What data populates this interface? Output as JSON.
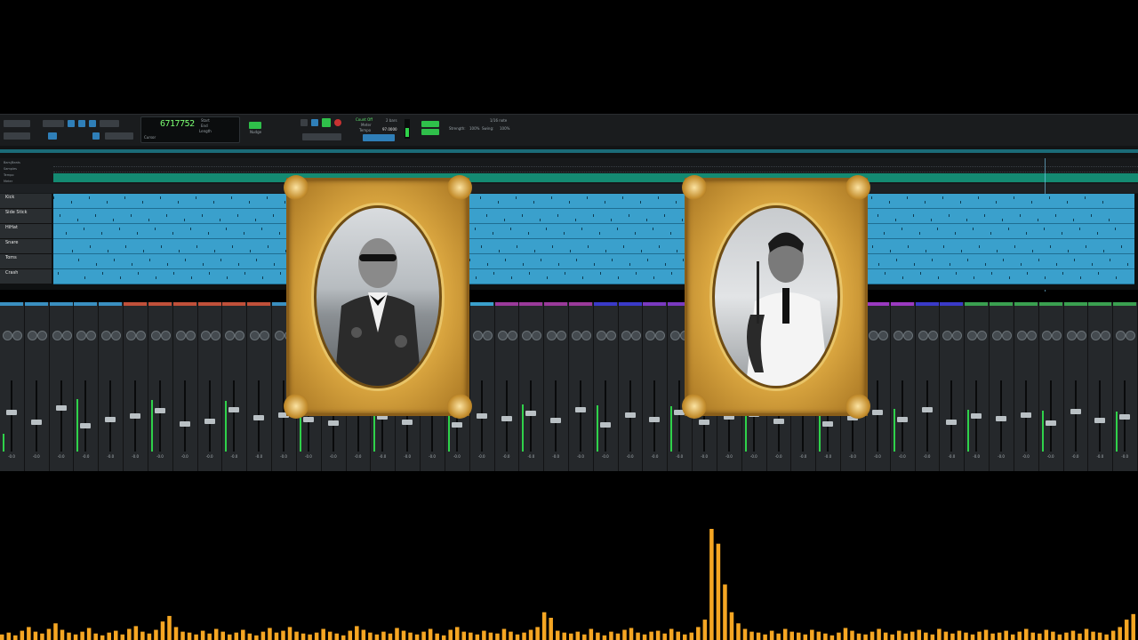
{
  "colors": {
    "accent_blue": "#2f7fb8",
    "counter_green": "#7bff72",
    "clip_blue": "#3aa0cc",
    "tempo_teal": "#148a72",
    "waveform_orange": "#f5a623",
    "frame_gold": "#d9a53f"
  },
  "toolbar": {
    "counter": "6717752",
    "start_label": "Start",
    "end_label": "End",
    "length_label": "Length",
    "cursor_label": "Cursor",
    "grid_label": "Grid",
    "nudge_label": "Nudge",
    "click_label": "Count Off",
    "meter_label": "Meter",
    "tempo_label": "Tempo",
    "tempo_value": "97.0000",
    "grid_value": "1/16 note",
    "strength_label": "Strength:",
    "strength_value": "100%",
    "swing_label": "Swing:",
    "swing_value": "100%",
    "pre_roll": "2 bars"
  },
  "rulers": {
    "labels": [
      "Bars|Beats",
      "Samples",
      "Tempo",
      "Meter",
      "Markers"
    ]
  },
  "tracks": [
    {
      "name": "Kick"
    },
    {
      "name": "Side Stick"
    },
    {
      "name": "HiHat"
    },
    {
      "name": "Snare"
    },
    {
      "name": "Toms"
    },
    {
      "name": "Crash"
    }
  ],
  "mixer": {
    "strip_count": 46,
    "levels": [
      0.55,
      0.4,
      0.62,
      0.35,
      0.45,
      0.5,
      0.58,
      0.38,
      0.42,
      0.6,
      0.47,
      0.52,
      0.44,
      0.39,
      0.63,
      0.48,
      0.41,
      0.57,
      0.36,
      0.5,
      0.46,
      0.54,
      0.43,
      0.59,
      0.37,
      0.51,
      0.45,
      0.56,
      0.4,
      0.49,
      0.53,
      0.42,
      0.58,
      0.38,
      0.47,
      0.55,
      0.44,
      0.6,
      0.41,
      0.5,
      0.46,
      0.52,
      0.39,
      0.57,
      0.43,
      0.48
    ],
    "strip_colors": [
      "#3a8fc0",
      "#3a8fc0",
      "#3a8fc0",
      "#3a8fc0",
      "#3a8fc0",
      "#c0503a",
      "#c0503a",
      "#c0503a",
      "#c0503a",
      "#c0503a",
      "#c0503a",
      "#3a8fc0",
      "#3a8fc0",
      "#3a8fc0",
      "#3a8fc0",
      "#3a8fc0",
      "#3a8fc0",
      "#3a8fc0",
      "#3a8fc0",
      "#3aa0cc",
      "#9a3a9a",
      "#9a3a9a",
      "#9a3a9a",
      "#9a3a9a",
      "#3a3ac8",
      "#3a3ac8",
      "#7a3ac0",
      "#7a3ac0",
      "#3aa050",
      "#3aa050",
      "#3aa050",
      "#3aa050",
      "#3aa050",
      "#3aa050",
      "#3aa050",
      "#9a3ac0",
      "#9a3ac0",
      "#3a3ac8",
      "#3a3ac8",
      "#3aa050",
      "#3aa050",
      "#3aa050",
      "#3aa050",
      "#3aa050",
      "#3aa050",
      "#3aa050"
    ],
    "vol_value": "-0.0"
  },
  "portraits": [
    {
      "name": "left-portrait"
    },
    {
      "name": "right-portrait"
    }
  ],
  "waveform": {
    "bars": [
      6,
      8,
      5,
      10,
      14,
      9,
      7,
      12,
      18,
      11,
      8,
      6,
      9,
      13,
      7,
      5,
      8,
      10,
      6,
      12,
      15,
      9,
      7,
      11,
      20,
      26,
      14,
      9,
      8,
      6,
      10,
      7,
      12,
      9,
      6,
      8,
      11,
      7,
      5,
      9,
      13,
      8,
      10,
      14,
      9,
      7,
      6,
      8,
      12,
      9,
      7,
      5,
      10,
      15,
      11,
      8,
      6,
      9,
      7,
      13,
      10,
      8,
      6,
      9,
      12,
      7,
      5,
      11,
      14,
      9,
      8,
      6,
      10,
      8,
      7,
      12,
      9,
      6,
      8,
      11,
      14,
      30,
      24,
      10,
      8,
      7,
      9,
      6,
      12,
      8,
      5,
      9,
      7,
      11,
      13,
      8,
      6,
      9,
      10,
      7,
      12,
      9,
      6,
      8,
      14,
      22,
      120,
      104,
      60,
      30,
      18,
      12,
      9,
      8,
      6,
      10,
      7,
      12,
      9,
      8,
      6,
      11,
      9,
      7,
      5,
      8,
      13,
      10,
      7,
      6,
      9,
      12,
      8,
      6,
      10,
      7,
      9,
      11,
      8,
      6,
      12,
      9,
      7,
      10,
      8,
      6,
      9,
      11,
      7,
      8,
      10,
      6,
      9,
      12,
      8,
      7,
      11,
      9,
      6,
      8,
      10,
      7,
      12,
      9,
      8,
      6,
      10,
      14,
      22,
      28
    ]
  }
}
